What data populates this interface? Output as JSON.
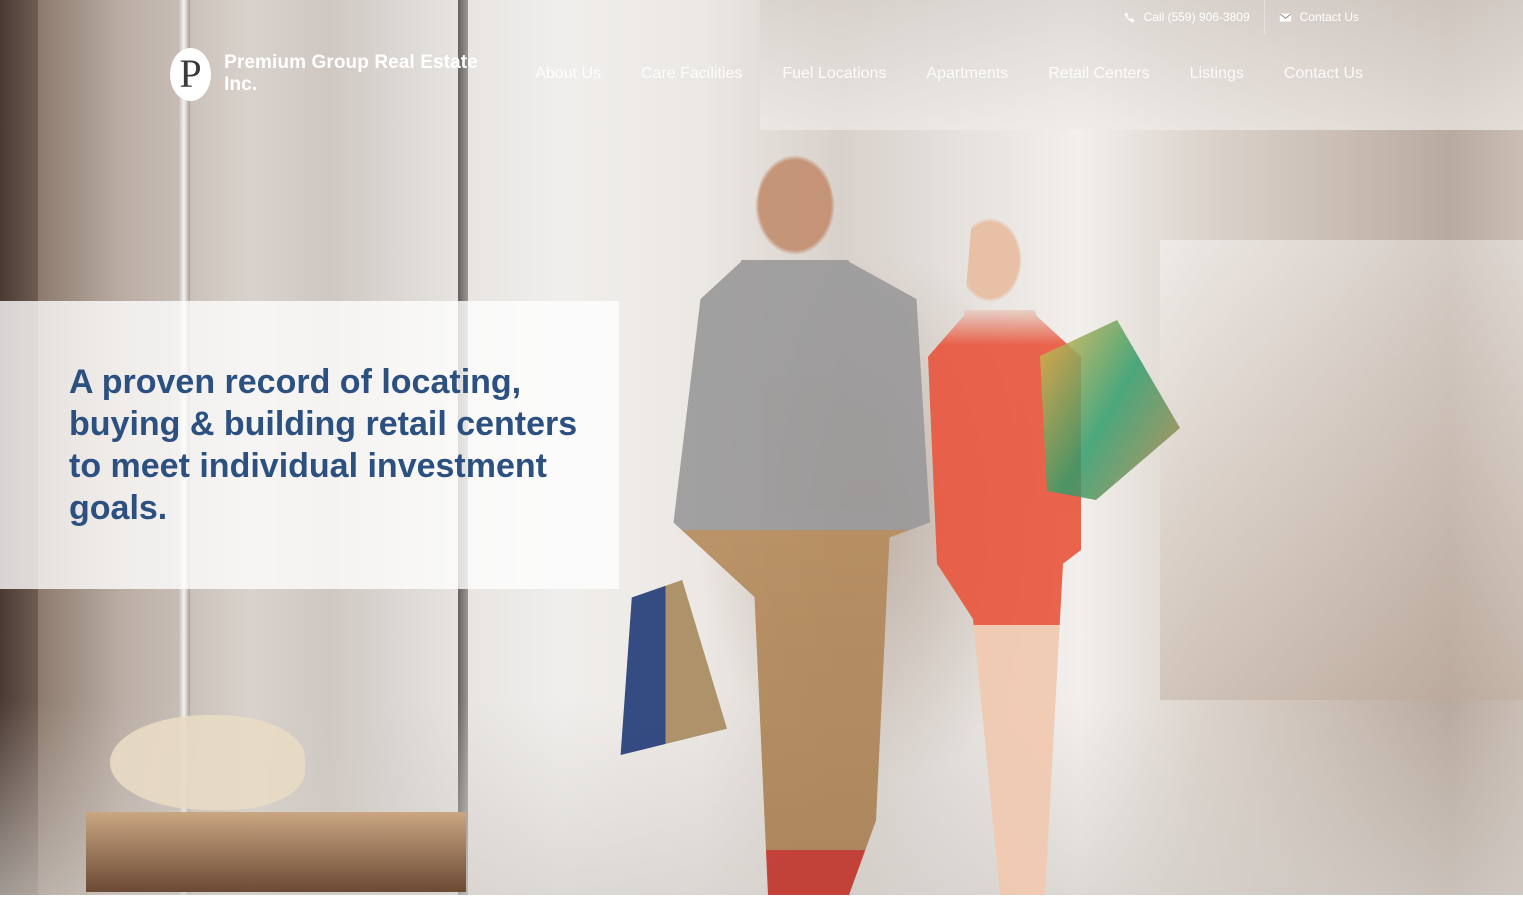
{
  "topbar": {
    "phone_icon": "phone-icon",
    "phone_label": "Call (559) 906-3809",
    "mail_icon": "envelope-icon",
    "contact_label": "Contact Us"
  },
  "brand": {
    "logo_letter": "P",
    "name": "Premium Group Real Estate Inc."
  },
  "nav": {
    "items": [
      {
        "label": "About Us"
      },
      {
        "label": "Care Facilities"
      },
      {
        "label": "Fuel Locations"
      },
      {
        "label": "Apartments"
      },
      {
        "label": "Retail Centers"
      },
      {
        "label": "Listings"
      },
      {
        "label": "Contact Us"
      }
    ]
  },
  "hero": {
    "headline": "A proven record of locating, buying & building retail centers to meet individual investment goals.",
    "image": "couple-shopping-in-mall-photo"
  },
  "colors": {
    "headline": "#2c5080",
    "panel": "#ffffff"
  }
}
